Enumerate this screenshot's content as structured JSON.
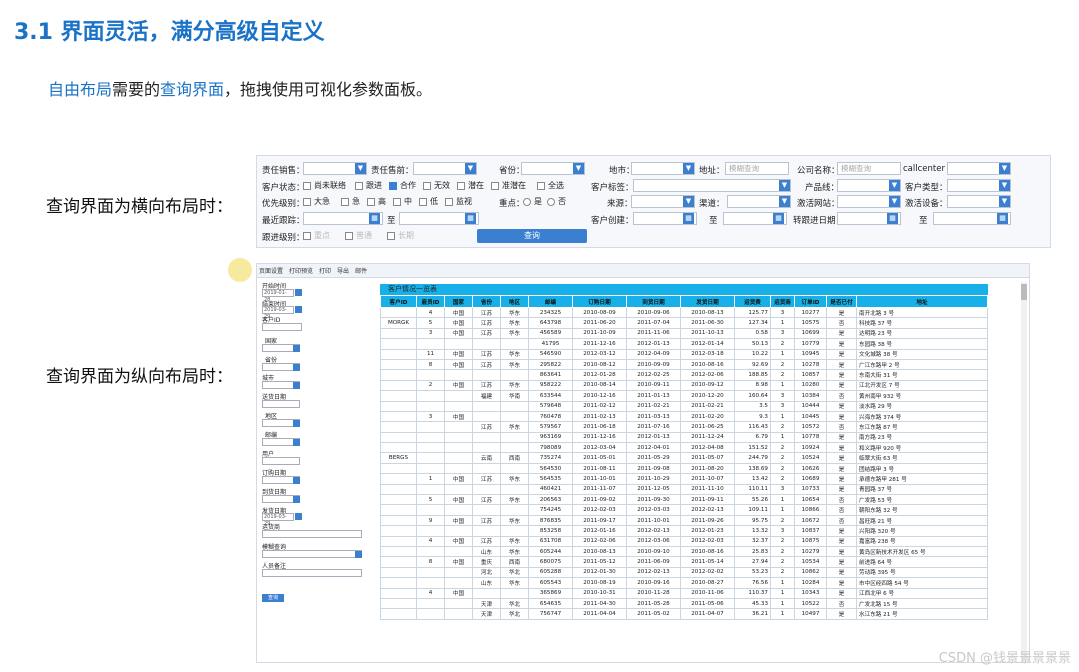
{
  "heading": "3.1 界面灵活，满分高级自定义",
  "subtitle": {
    "p1": "自由布局",
    "p2": "需要的",
    "p3": "查询界面",
    "p4": "，拖拽使用可视化参数面板。"
  },
  "label_horizontal": "查询界面为横向布局时：",
  "label_vertical": "查询界面为纵向布局时：",
  "hpanel": {
    "row1": {
      "sales": "责任销售：",
      "presale": "责任售前：",
      "province": "省份：",
      "city": "地市：",
      "address": "地址：",
      "address_ph": "模糊查询",
      "company": "公司名称：",
      "company_ph": "模糊查询",
      "callcenter": "callcenter"
    },
    "row2": {
      "status": "客户状态：",
      "opts": [
        "尚未联络",
        "跟进",
        "合作",
        "无效",
        "潜在",
        "准潜在",
        "全选"
      ],
      "tags": "客户标签：",
      "product": "产品线：",
      "ctype": "客户类型："
    },
    "row3": {
      "priority": "优先级别：",
      "opts": [
        "大急",
        "急",
        "高",
        "中",
        "低",
        "监视"
      ],
      "key": "重点：",
      "yes": "是",
      "no": "否",
      "source": "来源：",
      "channel": "渠道：",
      "activate_ch": "激活网站：",
      "activate_dev": "激活设备："
    },
    "row4": {
      "recent": "最近跟踪：",
      "to": "至",
      "created": "客户创建：",
      "to2": "至",
      "converted": "转跟进日期：",
      "to3": "至"
    },
    "row5": {
      "followup": "跟进级别：",
      "opts": [
        "重点",
        "普通",
        "长期"
      ],
      "query": "查询"
    }
  },
  "toolbar": [
    "页面设置",
    "打印预览",
    "打印",
    "导出",
    "邮件"
  ],
  "vside": {
    "labels": [
      "开始时间",
      "结束时间",
      "客户ID",
      "国家",
      "省份",
      "城市",
      "送货日期",
      "地区",
      "邮编",
      "用户",
      "订购日期",
      "到货日期",
      "发货日期",
      "运货商",
      "模糊查询",
      "人员备注"
    ],
    "date1": "2019-01-28",
    "date2": "2019-03-29",
    "date3": "2019-03-29",
    "query": "查询"
  },
  "report": {
    "title": "客户情况一览表",
    "columns": [
      "客户ID",
      "雇员ID",
      "国家",
      "省份",
      "地区",
      "邮编",
      "订购日期",
      "到货日期",
      "发货日期",
      "运货费",
      "运货商",
      "订单ID",
      "是否已付",
      "地址"
    ],
    "rows": [
      [
        "",
        "4",
        "中国",
        "江苏",
        "华东",
        "234325",
        "2010-08-09",
        "2010-09-06",
        "2010-08-13",
        "125.77",
        "3",
        "10277",
        "是",
        "南开北路 3 号"
      ],
      [
        "MORGK",
        "5",
        "中国",
        "江苏",
        "华东",
        "643798",
        "2011-06-20",
        "2011-07-04",
        "2011-06-30",
        "127.34",
        "1",
        "10575",
        "否",
        "科技路 37 号"
      ],
      [
        "",
        "3",
        "中国",
        "江苏",
        "华东",
        "456589",
        "2011-10-09",
        "2011-11-06",
        "2011-10-13",
        "0.58",
        "3",
        "10699",
        "是",
        "达明路 23 号"
      ],
      [
        "",
        "",
        "",
        "",
        "",
        "41795",
        "2011-12-16",
        "2012-01-13",
        "2012-01-14",
        "50.13",
        "2",
        "10779",
        "是",
        "东园路 38 号"
      ],
      [
        "",
        "11",
        "中国",
        "江苏",
        "华东",
        "546590",
        "2012-03-12",
        "2012-04-09",
        "2012-03-18",
        "10.22",
        "1",
        "10945",
        "是",
        "文化城路 38 号"
      ],
      [
        "",
        "8",
        "中国",
        "江苏",
        "华东",
        "295822",
        "2010-08-12",
        "2010-09-09",
        "2010-08-16",
        "92.69",
        "2",
        "10278",
        "是",
        "广江东路甲 2 号"
      ],
      [
        "",
        "",
        "",
        "",
        "",
        "863641",
        "2012-01-28",
        "2012-02-25",
        "2012-02-06",
        "188.85",
        "2",
        "10857",
        "是",
        "东南大街 31 号"
      ],
      [
        "",
        "2",
        "中国",
        "江苏",
        "华东",
        "958222",
        "2010-08-14",
        "2010-09-11",
        "2010-09-12",
        "8.98",
        "1",
        "10280",
        "是",
        "江北开发区 7 号"
      ],
      [
        "",
        "",
        "",
        "福建",
        "华南",
        "633544",
        "2010-12-16",
        "2011-01-13",
        "2010-12-20",
        "160.64",
        "3",
        "10384",
        "否",
        "黄州南甲 932 号"
      ],
      [
        "",
        "",
        "",
        "",
        "",
        "579648",
        "2011-02-12",
        "2011-02-21",
        "2011-02-21",
        "3.5",
        "3",
        "10444",
        "是",
        "淡水路 29 号"
      ],
      [
        "",
        "3",
        "中国",
        "",
        "",
        "760478",
        "2011-02-13",
        "2011-03-13",
        "2011-02-20",
        "9.3",
        "1",
        "10445",
        "是",
        "兴海东路 374 号"
      ],
      [
        "",
        "",
        "",
        "江苏",
        "华东",
        "579567",
        "2011-06-18",
        "2011-07-16",
        "2011-06-25",
        "116.43",
        "2",
        "10572",
        "否",
        "东江东路 87 号"
      ],
      [
        "",
        "",
        "",
        "",
        "",
        "963169",
        "2011-12-16",
        "2012-01-13",
        "2011-12-24",
        "6.79",
        "1",
        "10778",
        "是",
        "南方路 23 号"
      ],
      [
        "",
        "",
        "",
        "",
        "",
        "798089",
        "2012-03-04",
        "2012-04-01",
        "2012-04-08",
        "151.52",
        "2",
        "10924",
        "是",
        "和义路甲 920 号"
      ],
      [
        "BERGS",
        "",
        "",
        "云南",
        "西南",
        "735274",
        "2011-05-01",
        "2011-05-29",
        "2011-05-07",
        "244.79",
        "2",
        "10524",
        "是",
        "临翠大街 63 号"
      ],
      [
        "",
        "",
        "",
        "",
        "",
        "564530",
        "2011-08-11",
        "2011-09-08",
        "2011-08-20",
        "138.69",
        "2",
        "10626",
        "是",
        "团结路甲 3 号"
      ],
      [
        "",
        "1",
        "中国",
        "江苏",
        "华东",
        "564535",
        "2011-10-01",
        "2011-10-29",
        "2011-10-07",
        "13.42",
        "2",
        "10689",
        "是",
        "承德东路甲 281 号"
      ],
      [
        "",
        "",
        "",
        "",
        "",
        "460421",
        "2011-11-07",
        "2011-12-05",
        "2011-11-10",
        "110.11",
        "3",
        "10733",
        "是",
        "青园路 37 号"
      ],
      [
        "",
        "5",
        "中国",
        "江苏",
        "华东",
        "206563",
        "2011-09-02",
        "2011-09-30",
        "2011-09-11",
        "55.26",
        "1",
        "10654",
        "否",
        "广发路 53 号"
      ],
      [
        "",
        "",
        "",
        "",
        "",
        "754245",
        "2012-02-03",
        "2012-03-03",
        "2012-02-13",
        "109.11",
        "1",
        "10866",
        "否",
        "朝阳东路 32 号"
      ],
      [
        "",
        "9",
        "中国",
        "江苏",
        "华东",
        "876835",
        "2011-09-17",
        "2011-10-01",
        "2011-09-26",
        "95.75",
        "2",
        "10672",
        "否",
        "昌旺路 21 号"
      ],
      [
        "",
        "",
        "",
        "",
        "",
        "853258",
        "2012-01-16",
        "2012-02-13",
        "2012-01-23",
        "13.32",
        "3",
        "10837",
        "是",
        "兴阳路 320 号"
      ],
      [
        "",
        "4",
        "中国",
        "江苏",
        "华东",
        "631708",
        "2012-02-06",
        "2012-03-06",
        "2012-02-03",
        "32.37",
        "2",
        "10875",
        "是",
        "嘉富路 238 号"
      ],
      [
        "",
        "",
        "",
        "山东",
        "华东",
        "605244",
        "2010-08-13",
        "2010-09-10",
        "2010-08-16",
        "25.83",
        "2",
        "10279",
        "是",
        "黄岛区新技术开发区 65 号"
      ],
      [
        "",
        "8",
        "中国",
        "重庆",
        "西南",
        "680075",
        "2011-05-12",
        "2011-06-09",
        "2011-05-14",
        "27.94",
        "2",
        "10534",
        "是",
        "前进路 64 号"
      ],
      [
        "",
        "",
        "",
        "河北",
        "华北",
        "605288",
        "2012-01-30",
        "2012-02-13",
        "2012-02-02",
        "53.23",
        "2",
        "10862",
        "是",
        "劳动路 395 号"
      ],
      [
        "",
        "",
        "",
        "山东",
        "华东",
        "605543",
        "2010-08-19",
        "2010-09-16",
        "2010-08-27",
        "76.56",
        "1",
        "10284",
        "是",
        "市中区经四路 54 号"
      ],
      [
        "",
        "4",
        "中国",
        "",
        "",
        "365869",
        "2010-10-31",
        "2010-11-28",
        "2010-11-06",
        "110.37",
        "1",
        "10343",
        "是",
        "江西北甲 6 号"
      ],
      [
        "",
        "",
        "",
        "天津",
        "华北",
        "654635",
        "2011-04-30",
        "2011-05-28",
        "2011-05-06",
        "45.33",
        "1",
        "10522",
        "否",
        "广发北路 15 号"
      ],
      [
        "",
        "",
        "",
        "天津",
        "华北",
        "756747",
        "2011-04-04",
        "2011-05-02",
        "2011-04-07",
        "36.21",
        "1",
        "10497",
        "是",
        "水江东路 21 号"
      ]
    ]
  },
  "watermark": "CSDN @钱景景景景景",
  "colors": {
    "accent": "#1a73c7",
    "header": "#17b0e8",
    "button": "#3a7fd0"
  }
}
